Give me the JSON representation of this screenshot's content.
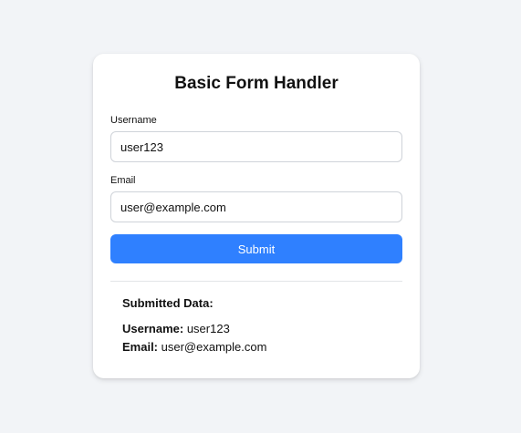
{
  "form": {
    "title": "Basic Form Handler",
    "username_label": "Username",
    "username_value": "user123",
    "email_label": "Email",
    "email_value": "user@example.com",
    "submit_label": "Submit"
  },
  "result": {
    "heading": "Submitted Data:",
    "username_key": "Username:",
    "username_value": "user123",
    "email_key": "Email:",
    "email_value": "user@example.com"
  },
  "colors": {
    "background": "#f2f4f7",
    "card": "#ffffff",
    "accent": "#2f80ff"
  }
}
